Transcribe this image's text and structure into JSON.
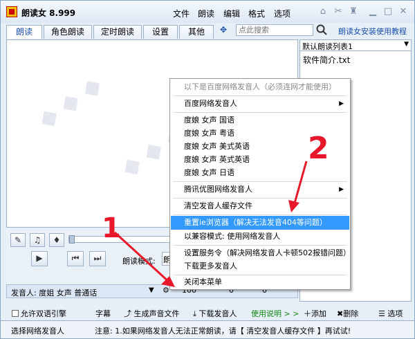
{
  "app": {
    "title": "朗读女 8.999"
  },
  "menu": [
    "文件",
    "朗读",
    "编辑",
    "格式",
    "选项"
  ],
  "tabs": [
    "朗读",
    "角色朗读",
    "定时朗读",
    "设置",
    "其他"
  ],
  "search": {
    "placeholder": "点此搜索"
  },
  "help_link": "朗读女安装使用教程",
  "playlist": {
    "selected": "默认朗读列表1",
    "items": [
      "软件简介.txt"
    ]
  },
  "player": {
    "mode_label": "朗读模式:",
    "mode_value": "朗"
  },
  "voice": {
    "label": "发音人: 度姐 女声 普通话",
    "speed_value": "100",
    "pitch_value": "0",
    "volume_value": "0"
  },
  "options": {
    "dual_engine": "允许双语引擎",
    "subtitle": "字幕",
    "gen_audio": "生成声音文件",
    "download": "下载发音人",
    "usage": "使用说明 > >",
    "add": "添加",
    "delete": "删除",
    "select": "选项"
  },
  "status": {
    "left": "选择网络发音人",
    "right": "注意: 1.如果网络发音人无法正常朗读，请【 清空发音人缓存文件 】再试试!"
  },
  "context_menu": {
    "header": "以下是百度网络发音人（必须连网才能使用）",
    "items": [
      "百度网络发音人",
      "度娘 女声 国语",
      "度娘 女声 粤语",
      "度娘 女声 美式英语",
      "度娘 女声 英式英语",
      "度娘 女声 日语",
      "腾讯优图网络发音人",
      "清空发音人缓存文件",
      "重置ie浏览器（解决无法发音404等问题）",
      "以兼容模式: 使用网络发音人",
      "设置服务令（解决网络发音人卡顿502报错问题）",
      "下载更多发音人",
      "关闭本菜单"
    ]
  },
  "annotations": {
    "one": "1",
    "two": "2"
  },
  "colors": {
    "accent": "#1a4fb0",
    "highlight": "#3399ff",
    "annotation": "#e8182a"
  }
}
